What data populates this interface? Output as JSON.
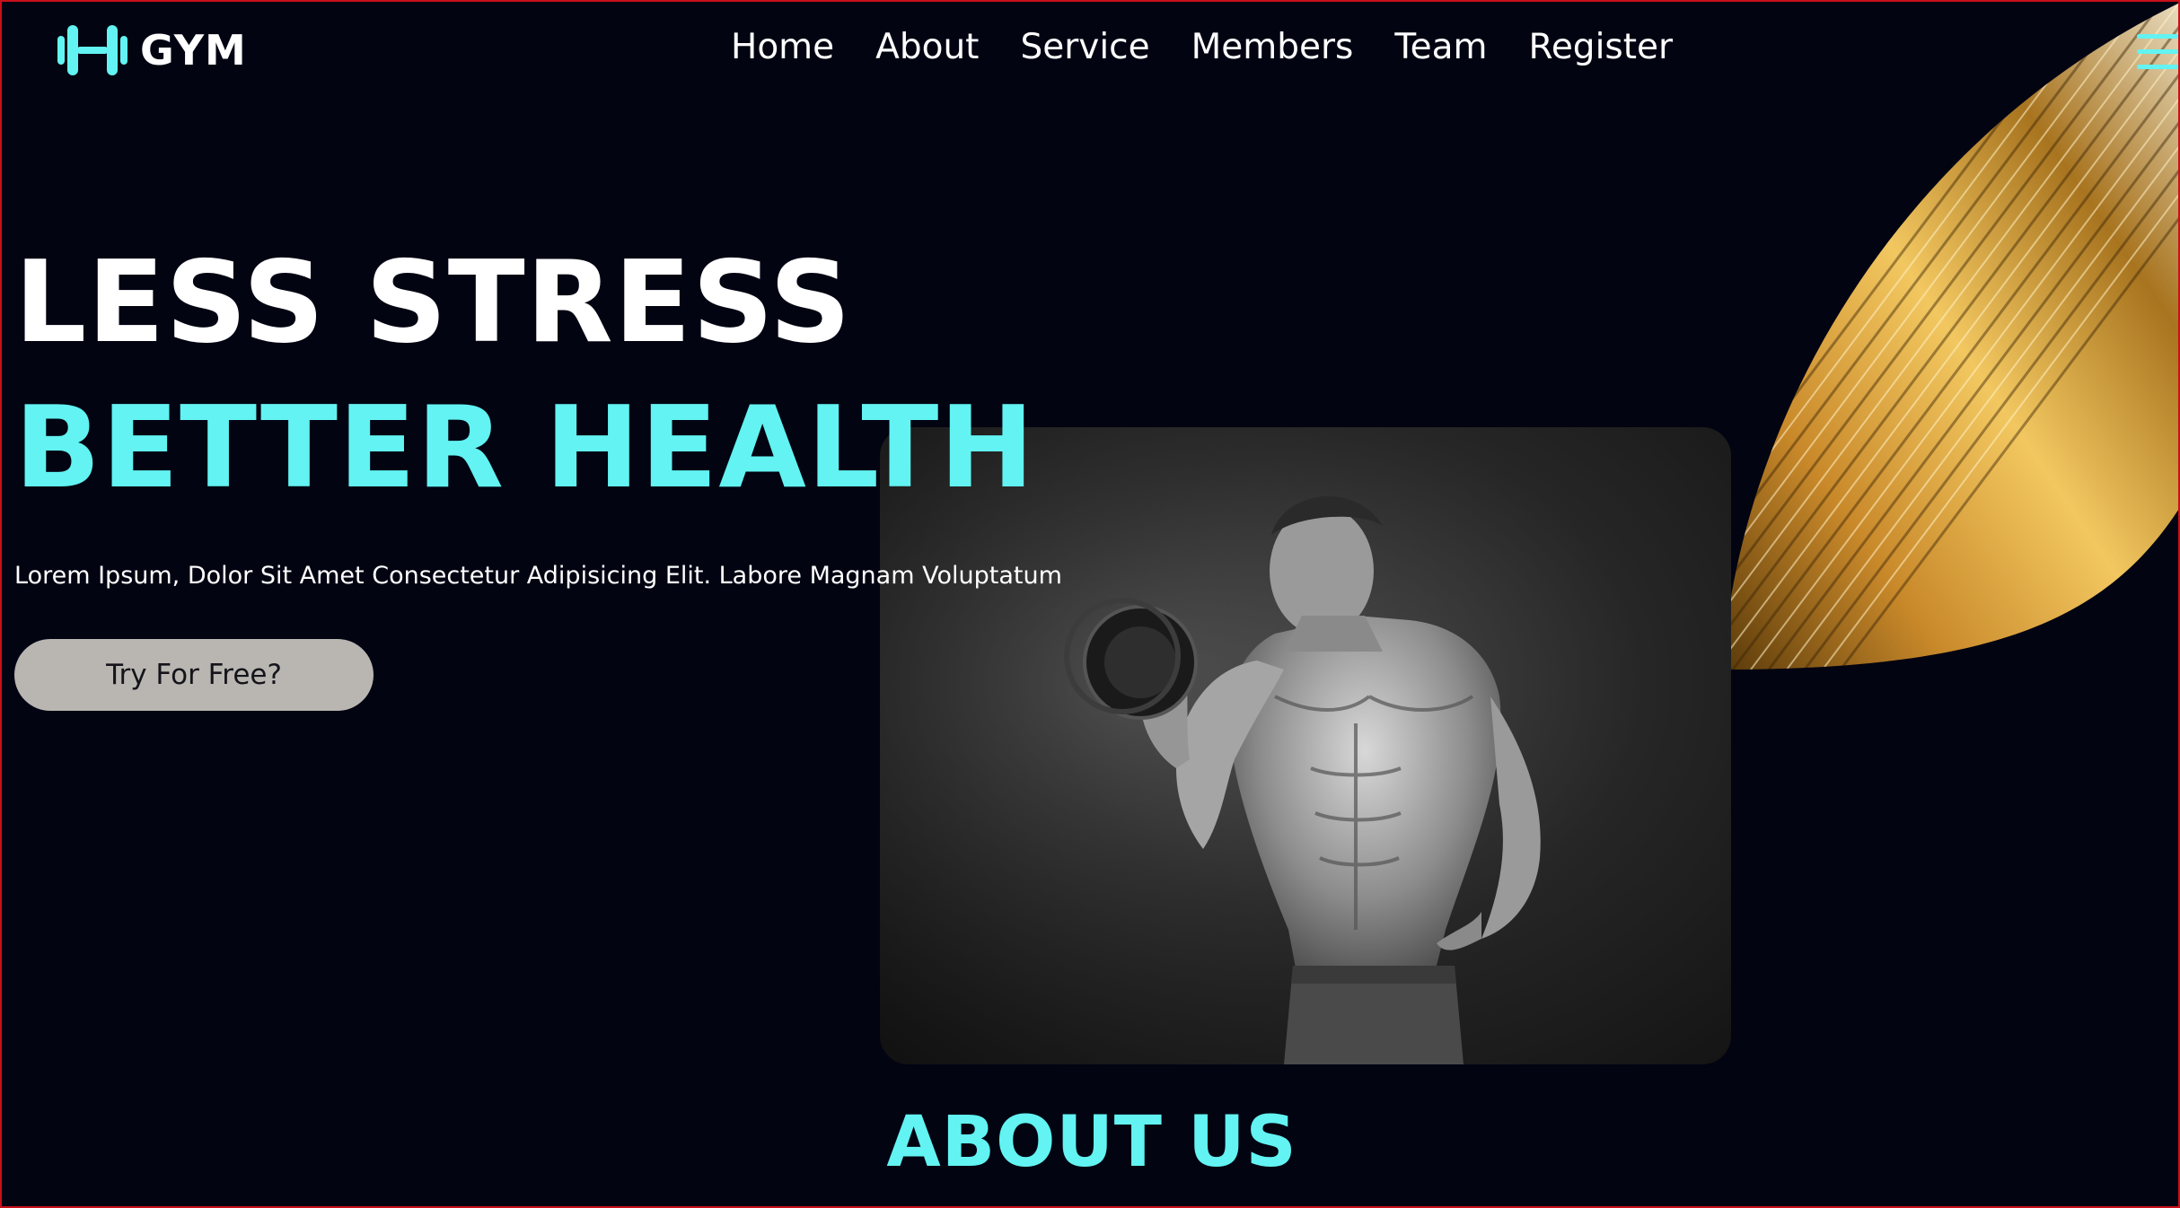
{
  "header": {
    "logo_text": "GYM",
    "logo_icon": "dumbbell-icon",
    "nav": [
      {
        "label": "Home"
      },
      {
        "label": "About"
      },
      {
        "label": "Service"
      },
      {
        "label": "Members"
      },
      {
        "label": "Team"
      },
      {
        "label": "Register"
      }
    ],
    "menu_icon": "hamburger-menu-icon"
  },
  "hero": {
    "headline_line1": "LESS STRESS",
    "headline_line2": "BETTER HEALTH",
    "description": "Lorem Ipsum, Dolor Sit Amet Consectetur Adipisicing Elit. Labore Magnam Voluptatum",
    "cta_label": "Try For Free?"
  },
  "about": {
    "title": "ABOUT US"
  },
  "colors": {
    "background": "#020412",
    "accent": "#62f3f2",
    "text": "#ffffff",
    "button_bg": "#b9b6b2",
    "frame_border": "#c8111a",
    "swoosh": "#d9a43a"
  }
}
